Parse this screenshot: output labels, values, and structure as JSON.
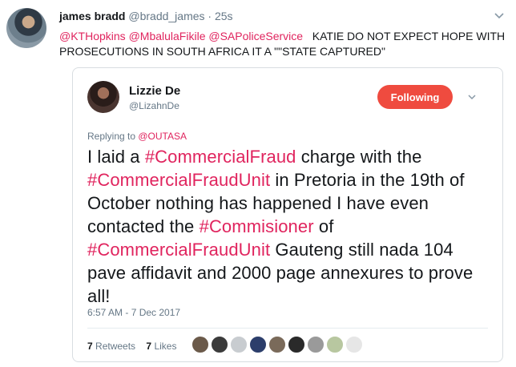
{
  "tweet": {
    "name": "james bradd",
    "handle": "@bradd_james",
    "separator": "·",
    "time": "25s",
    "mentions": "@KTHopkins @MbalulaFikile @SAPoliceService",
    "text": "KATIE DO NOT EXPECT HOPE WITH PROSECUTIONS IN SOUTH AFRICA  IT A \"\"STATE CAPTURED\""
  },
  "quoted": {
    "name": "Lizzie De",
    "handle": "@LizahnDe",
    "follow_label": "Following",
    "replying_prefix": "Replying to ",
    "replying_to": "@OUTASA",
    "text_parts": [
      {
        "t": "I laid a ",
        "tag": false
      },
      {
        "t": "#CommercialFraud",
        "tag": true
      },
      {
        "t": " charge with the ",
        "tag": false
      },
      {
        "t": "#CommercialFraudUnit",
        "tag": true
      },
      {
        "t": " in Pretoria in the 19th of October nothing has happened I have even contacted the ",
        "tag": false
      },
      {
        "t": "#Commisioner",
        "tag": true
      },
      {
        "t": " of ",
        "tag": false
      },
      {
        "t": "#CommercialFraudUnit",
        "tag": true
      },
      {
        "t": " Gauteng still nada 104 pave affidavit and 2000 page annexures to prove all!",
        "tag": false
      }
    ],
    "date": "6:57 AM - 7 Dec 2017",
    "retweets_count": "7",
    "retweets_label": "Retweets",
    "likes_count": "7",
    "likes_label": "Likes",
    "liker_colors": [
      "#6b5a4a",
      "#3b3b3b",
      "#c8ccd0",
      "#2c3e6b",
      "#7a6a5a",
      "#2a2a2a",
      "#9a9a9a",
      "#b8c7a0",
      "#e6e6e6"
    ]
  },
  "colors": {
    "accent": "#e0245e",
    "follow_button": "#ef4b3f",
    "muted": "#657786"
  }
}
